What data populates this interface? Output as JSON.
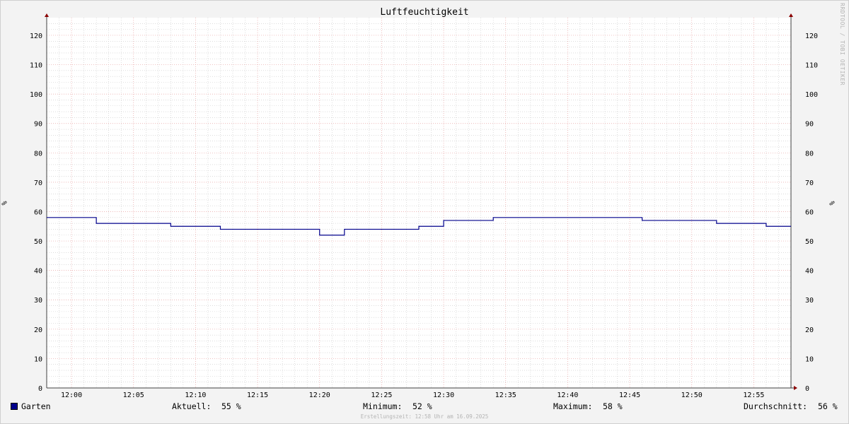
{
  "chart_data": {
    "type": "line",
    "title": "Luftfeuchtigkeit",
    "ylabel": "%",
    "ylabel_right": "%",
    "ylim": [
      0,
      126
    ],
    "yticks": [
      0,
      10,
      20,
      30,
      40,
      50,
      60,
      70,
      80,
      90,
      100,
      110,
      120
    ],
    "xlim": [
      "11:58",
      "12:58"
    ],
    "xticks": [
      "12:00",
      "12:05",
      "12:10",
      "12:15",
      "12:20",
      "12:25",
      "12:30",
      "12:35",
      "12:40",
      "12:45",
      "12:50",
      "12:55"
    ],
    "grid": true,
    "legend": "bottom-left",
    "series": [
      {
        "name": "Garten",
        "color": "#00008b",
        "step": true,
        "x": [
          "11:58",
          "12:02",
          "12:04",
          "12:08",
          "12:12",
          "12:20",
          "12:22",
          "12:28",
          "12:30",
          "12:32",
          "12:34",
          "12:46",
          "12:52",
          "12:56",
          "12:58"
        ],
        "values": [
          58,
          56,
          56,
          55,
          54,
          52,
          54,
          55,
          57,
          57,
          58,
          57,
          56,
          55,
          55
        ]
      }
    ]
  },
  "legend": {
    "series_name": "Garten",
    "aktuell_label": "Aktuell:",
    "aktuell_value": "55 %",
    "minimum_label": "Minimum:",
    "minimum_value": "52 %",
    "maximum_label": "Maximum:",
    "maximum_value": "58 %",
    "durchschnitt_label": "Durchschnitt:",
    "durchschnitt_value": "56 %"
  },
  "watermark": "RRDTOOL / TOBI OETIKER",
  "footer": "Erstellungszeit: 12:58 Uhr am 16.09.2025",
  "colors": {
    "background": "#f3f3f3",
    "plot_background": "#ffffff",
    "major_grid": "#e8a0a0",
    "minor_grid": "#c8c8c8",
    "axis": "#404040",
    "arrow": "#8b0000",
    "series": "#00008b"
  }
}
